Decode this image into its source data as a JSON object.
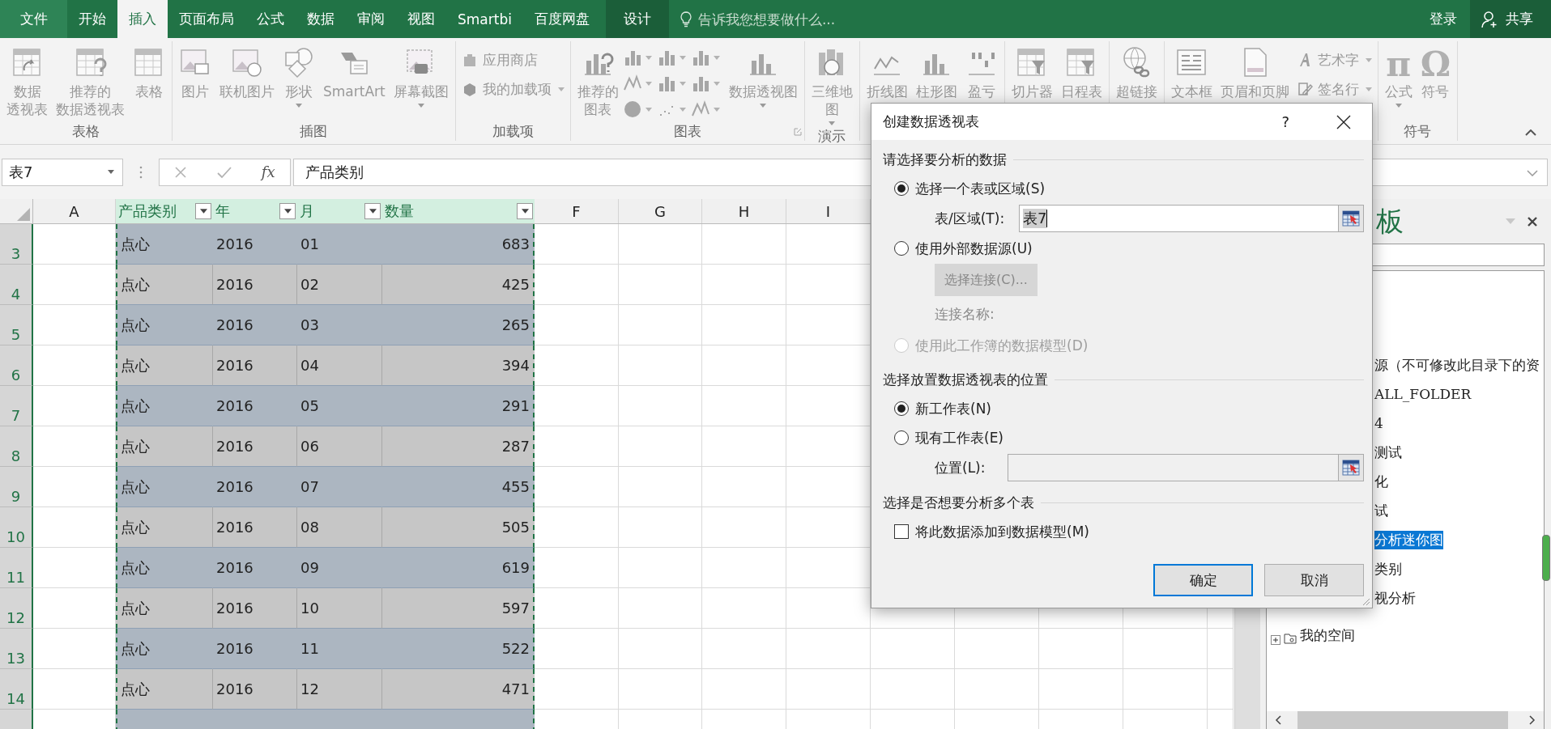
{
  "title_bar": {
    "tabs": [
      {
        "label": "文件",
        "kind": "file",
        "selected": false
      },
      {
        "label": "开始",
        "kind": "tab",
        "selected": false
      },
      {
        "label": "插入",
        "kind": "tab",
        "selected": true
      },
      {
        "label": "页面布局",
        "kind": "tab",
        "selected": false
      },
      {
        "label": "公式",
        "kind": "tab",
        "selected": false
      },
      {
        "label": "数据",
        "kind": "tab",
        "selected": false
      },
      {
        "label": "审阅",
        "kind": "tab",
        "selected": false
      },
      {
        "label": "视图",
        "kind": "tab",
        "selected": false
      },
      {
        "label": "Smartbi",
        "kind": "tab",
        "selected": false
      },
      {
        "label": "百度网盘",
        "kind": "tab",
        "selected": false
      },
      {
        "label": "设计",
        "kind": "context",
        "selected": false
      }
    ],
    "tell_me": {
      "placeholder": "告诉我您想要做什么..."
    },
    "sign_in": "登录",
    "share": "共享"
  },
  "ribbon": {
    "groups": [
      {
        "label": "表格",
        "items": [
          {
            "kind": "large",
            "lines": [
              "数据",
              "透视表"
            ]
          },
          {
            "kind": "large",
            "lines": [
              "推荐的",
              "数据透视表"
            ]
          },
          {
            "kind": "large",
            "lines": [
              "表格"
            ]
          }
        ]
      },
      {
        "label": "插图",
        "items": [
          {
            "kind": "large",
            "lines": [
              "图片"
            ]
          },
          {
            "kind": "large",
            "lines": [
              "联机图片"
            ]
          },
          {
            "kind": "large",
            "lines": [
              "形状"
            ],
            "dropdown": true
          },
          {
            "kind": "large",
            "lines": [
              "SmartArt"
            ]
          },
          {
            "kind": "large",
            "lines": [
              "屏幕截图"
            ],
            "dropdown": true
          }
        ]
      },
      {
        "label": "加载项",
        "items": [
          {
            "kind": "stack",
            "items": [
              {
                "label": "应用商店"
              },
              {
                "label": "我的加载项",
                "dropdown": true
              }
            ]
          }
        ]
      },
      {
        "label": "图表",
        "launcher": true,
        "items": [
          {
            "kind": "large",
            "lines": [
              "推荐的",
              "图表"
            ]
          },
          {
            "kind": "gallery"
          },
          {
            "kind": "large",
            "lines": [
              "数据透视图"
            ],
            "dropdown": true
          }
        ]
      },
      {
        "label": "演示",
        "items": [
          {
            "kind": "large",
            "lines": [
              "三维地",
              "图"
            ],
            "dropdown": true
          }
        ]
      },
      {
        "items": [
          {
            "kind": "large",
            "lines": [
              "折线图"
            ]
          },
          {
            "kind": "large",
            "lines": [
              "柱形图"
            ]
          },
          {
            "kind": "large",
            "lines": [
              "盈亏"
            ]
          }
        ]
      },
      {
        "items": [
          {
            "kind": "large",
            "lines": [
              "切片器"
            ]
          },
          {
            "kind": "large",
            "lines": [
              "日程表"
            ]
          }
        ]
      },
      {
        "items": [
          {
            "kind": "large",
            "lines": [
              "超链接"
            ]
          }
        ]
      },
      {
        "items": [
          {
            "kind": "large",
            "lines": [
              "文本框"
            ]
          },
          {
            "kind": "large",
            "lines": [
              "页眉和页脚"
            ]
          },
          {
            "kind": "stack",
            "items": [
              {
                "label": "艺术字",
                "dropdown": true
              },
              {
                "label": "签名行",
                "dropdown": true
              }
            ]
          }
        ]
      },
      {
        "label": "符号",
        "items": [
          {
            "kind": "large",
            "glyph": "π",
            "lines": [
              "公式"
            ],
            "dropdown": true
          },
          {
            "kind": "large",
            "glyph": "Ω",
            "lines": [
              "符号"
            ]
          }
        ]
      }
    ]
  },
  "formula_bar": {
    "name_box": "表7",
    "function_button": "fx",
    "formula": "产品类别"
  },
  "sheet": {
    "columns": [
      {
        "label": "A",
        "kind": "plain"
      },
      {
        "label": "产品类别",
        "kind": "table_header"
      },
      {
        "label": "年",
        "kind": "table_header"
      },
      {
        "label": "月",
        "kind": "table_header"
      },
      {
        "label": "数量",
        "kind": "table_header"
      },
      {
        "label": "F",
        "kind": "plain"
      },
      {
        "label": "G",
        "kind": "plain"
      },
      {
        "label": "H",
        "kind": "plain"
      },
      {
        "label": "I",
        "kind": "plain"
      }
    ],
    "rows": [
      {
        "number": "3",
        "cells": [
          "",
          "点心",
          "2016",
          "01",
          "683"
        ]
      },
      {
        "number": "4",
        "cells": [
          "",
          "点心",
          "2016",
          "02",
          "425"
        ]
      },
      {
        "number": "5",
        "cells": [
          "",
          "点心",
          "2016",
          "03",
          "265"
        ]
      },
      {
        "number": "6",
        "cells": [
          "",
          "点心",
          "2016",
          "04",
          "394"
        ]
      },
      {
        "number": "7",
        "cells": [
          "",
          "点心",
          "2016",
          "05",
          "291"
        ]
      },
      {
        "number": "8",
        "cells": [
          "",
          "点心",
          "2016",
          "06",
          "287"
        ]
      },
      {
        "number": "9",
        "cells": [
          "",
          "点心",
          "2016",
          "07",
          "455"
        ]
      },
      {
        "number": "10",
        "cells": [
          "",
          "点心",
          "2016",
          "08",
          "505"
        ]
      },
      {
        "number": "11",
        "cells": [
          "",
          "点心",
          "2016",
          "09",
          "619"
        ]
      },
      {
        "number": "12",
        "cells": [
          "",
          "点心",
          "2016",
          "10",
          "597"
        ]
      },
      {
        "number": "13",
        "cells": [
          "",
          "点心",
          "2016",
          "11",
          "522"
        ]
      },
      {
        "number": "14",
        "cells": [
          "",
          "点心",
          "2016",
          "12",
          "471"
        ]
      }
    ]
  },
  "task_pane": {
    "title": "板",
    "tree": [
      {
        "label": "源（不可修改此目录下的资",
        "kind": "clipped",
        "selected": false
      },
      {
        "label": "ALL_FOLDER",
        "kind": "clipped",
        "selected": false
      },
      {
        "label": "4",
        "kind": "clipped",
        "selected": false
      },
      {
        "label": "测试",
        "kind": "clipped",
        "selected": false
      },
      {
        "label": "化",
        "kind": "clipped",
        "selected": false
      },
      {
        "label": "试",
        "kind": "clipped",
        "selected": false
      },
      {
        "label": "分析迷你图",
        "kind": "clipped",
        "selected": true
      },
      {
        "label": "类别",
        "kind": "clipped",
        "selected": false
      },
      {
        "label": "视分析",
        "kind": "clipped",
        "selected": false
      },
      {
        "label": "我的空间",
        "kind": "node",
        "selected": false,
        "expanded": false
      }
    ]
  },
  "dialog": {
    "title": "创建数据透视表",
    "help": "?",
    "sections": [
      {
        "heading": "请选择要分析的数据",
        "controls": [
          {
            "kind": "radio",
            "label": "选择一个表或区域(S)",
            "selected": true,
            "disabled": false
          },
          {
            "kind": "field",
            "label": "表/区域(T):",
            "value": "表7",
            "disabled": false
          },
          {
            "kind": "radio",
            "label": "使用外部数据源(U)",
            "selected": false,
            "disabled": false
          },
          {
            "kind": "button",
            "label": "选择连接(C)...",
            "disabled": true
          },
          {
            "kind": "note",
            "label": "连接名称:",
            "disabled": true
          },
          {
            "kind": "radio",
            "label": "使用此工作簿的数据模型(D)",
            "selected": false,
            "disabled": true
          }
        ]
      },
      {
        "heading": "选择放置数据透视表的位置",
        "controls": [
          {
            "kind": "radio",
            "label": "新工作表(N)",
            "selected": true,
            "disabled": false
          },
          {
            "kind": "radio",
            "label": "现有工作表(E)",
            "selected": false,
            "disabled": false
          },
          {
            "kind": "field",
            "label": "位置(L):",
            "disabled": true
          }
        ]
      },
      {
        "heading": "选择是否想要分析多个表",
        "controls": [
          {
            "kind": "checkbox",
            "label": "将此数据添加到数据模型(M)",
            "checked": false,
            "disabled": false
          }
        ]
      }
    ],
    "buttons": [
      {
        "label": "确定",
        "default": true
      },
      {
        "label": "取消",
        "default": false
      }
    ]
  }
}
